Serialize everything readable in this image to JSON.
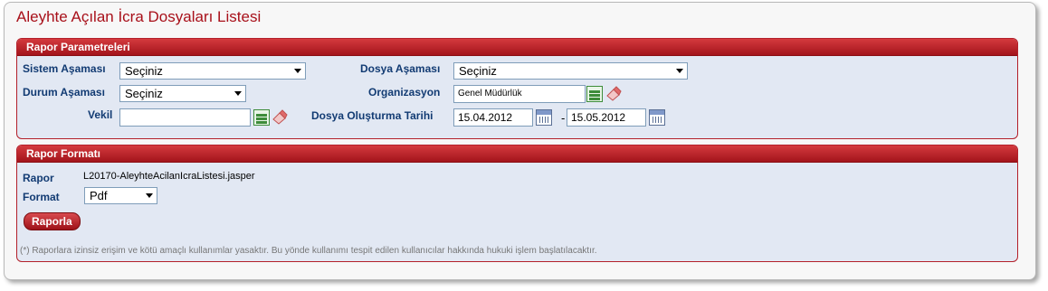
{
  "page": {
    "title": "Aleyhte Açılan İcra Dosyaları Listesi"
  },
  "params": {
    "header": "Rapor Parametreleri",
    "sistem_asamasi": {
      "label": "Sistem Aşaması",
      "value": "Seçiniz"
    },
    "durum_asamasi": {
      "label": "Durum Aşaması",
      "value": "Seçiniz"
    },
    "vekil": {
      "label": "Vekil",
      "value": ""
    },
    "dosya_asamasi": {
      "label": "Dosya Aşaması",
      "value": "Seçiniz"
    },
    "organizasyon": {
      "label": "Organizasyon",
      "value": "Genel Müdürlük"
    },
    "dosya_olusturma_tarihi": {
      "label": "Dosya Oluşturma Tarihi",
      "start": "15.04.2012",
      "separator": "-",
      "end": "15.05.2012"
    }
  },
  "format": {
    "header": "Rapor Formatı",
    "rapor_label": "Rapor",
    "rapor_value": "L20170-AleyhteAcilanIcraListesi.jasper",
    "format_label": "Format",
    "format_value": "Pdf",
    "button_label": "Raporla",
    "note": "(*) Raporlara izinsiz erişim ve kötü amaçlı kullanımlar yasaktır. Bu yönde kullanımı tespit edilen kullanıcılar hakkında hukuki işlem başlatılacaktır."
  },
  "icons": [
    "list-select-icon",
    "eraser-icon",
    "calendar-icon",
    "dropdown-arrow-icon"
  ],
  "colors": {
    "accent": "#a8101a",
    "label": "#123b73",
    "panel_bg": "#e2e8f3"
  }
}
